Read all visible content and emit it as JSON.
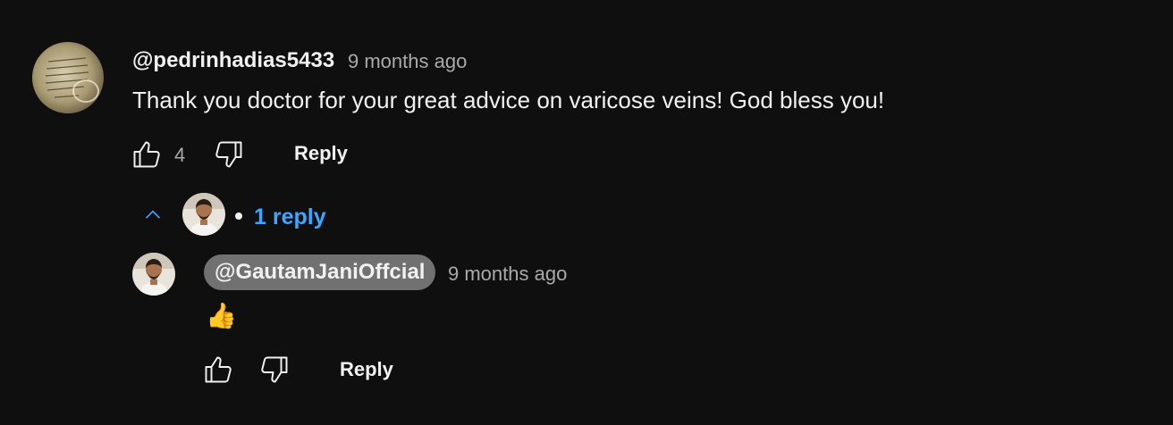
{
  "comment": {
    "author": "@pedrinhadias5433",
    "time": "9 months ago",
    "text": "Thank you doctor for your great advice on varicose veins! God bless you!",
    "like_count": "4",
    "reply_label": "Reply"
  },
  "replies_toggle": {
    "label": "1 reply",
    "accent_color": "#3ea6ff"
  },
  "reply": {
    "author": "@GautamJaniOffcial",
    "time": "9 months ago",
    "text": "👍",
    "reply_label": "Reply"
  },
  "icons": {
    "like": "thumbs-up-icon",
    "dislike": "thumbs-down-icon",
    "collapse": "chevron-up-icon"
  }
}
